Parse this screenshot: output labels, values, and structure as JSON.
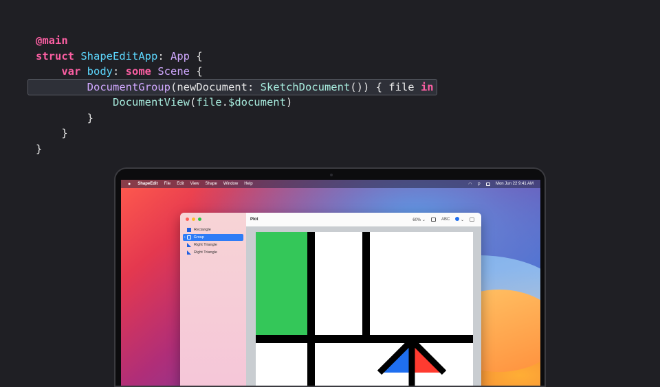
{
  "code": {
    "lines": [
      {
        "parts": [
          {
            "t": "@main",
            "c": "kw"
          }
        ]
      },
      {
        "parts": [
          {
            "t": "struct",
            "c": "kw"
          },
          {
            "t": " ",
            "c": ""
          },
          {
            "t": "ShapeEditApp",
            "c": "ty"
          },
          {
            "t": ": ",
            "c": ""
          },
          {
            "t": "App",
            "c": "ty2"
          },
          {
            "t": " {",
            "c": ""
          }
        ]
      },
      {
        "parts": [
          {
            "t": "    ",
            "c": ""
          },
          {
            "t": "var",
            "c": "kw"
          },
          {
            "t": " ",
            "c": ""
          },
          {
            "t": "body",
            "c": "ty"
          },
          {
            "t": ": ",
            "c": ""
          },
          {
            "t": "some",
            "c": "kw"
          },
          {
            "t": " ",
            "c": ""
          },
          {
            "t": "Scene",
            "c": "ty2"
          },
          {
            "t": " {",
            "c": ""
          }
        ]
      },
      {
        "parts": [
          {
            "t": "        ",
            "c": ""
          },
          {
            "t": "DocumentGroup",
            "c": "ty2"
          },
          {
            "t": "(newDocument: ",
            "c": ""
          },
          {
            "t": "SketchDocument",
            "c": "fn"
          },
          {
            "t": "()) { file ",
            "c": ""
          },
          {
            "t": "in",
            "c": "kw"
          }
        ]
      },
      {
        "parts": [
          {
            "t": "            ",
            "c": ""
          },
          {
            "t": "DocumentView",
            "c": "fn"
          },
          {
            "t": "(",
            "c": ""
          },
          {
            "t": "file",
            "c": "fn"
          },
          {
            "t": ".",
            "c": ""
          },
          {
            "t": "$document",
            "c": "fn"
          },
          {
            "t": ")",
            "c": ""
          }
        ]
      },
      {
        "parts": [
          {
            "t": "        }",
            "c": ""
          }
        ]
      },
      {
        "parts": [
          {
            "t": "    }",
            "c": ""
          }
        ]
      },
      {
        "parts": [
          {
            "t": "}",
            "c": ""
          }
        ]
      }
    ]
  },
  "menubar": {
    "apple": "",
    "app_name": "ShapeEdit",
    "items": [
      "File",
      "Edit",
      "View",
      "Shape",
      "Window",
      "Help"
    ],
    "clock": "Mon Jun 22  9:41 AM"
  },
  "window": {
    "title": "Plot",
    "zoom": "60% ⌄",
    "text_tool": "ABC",
    "color_chevron": "⌄",
    "sidebar_items": [
      {
        "label": "Rectangle",
        "icon": "rect"
      },
      {
        "label": "Group",
        "icon": "group",
        "selected": true
      },
      {
        "label": "Right Triangle",
        "icon": "tri"
      },
      {
        "label": "Right Triangle",
        "icon": "tri"
      }
    ]
  },
  "colors": {
    "accent": "#2f7cf6",
    "green_shape": "#34c759",
    "blue_shape": "#1f6ff0",
    "red_shape": "#ff3b30"
  }
}
